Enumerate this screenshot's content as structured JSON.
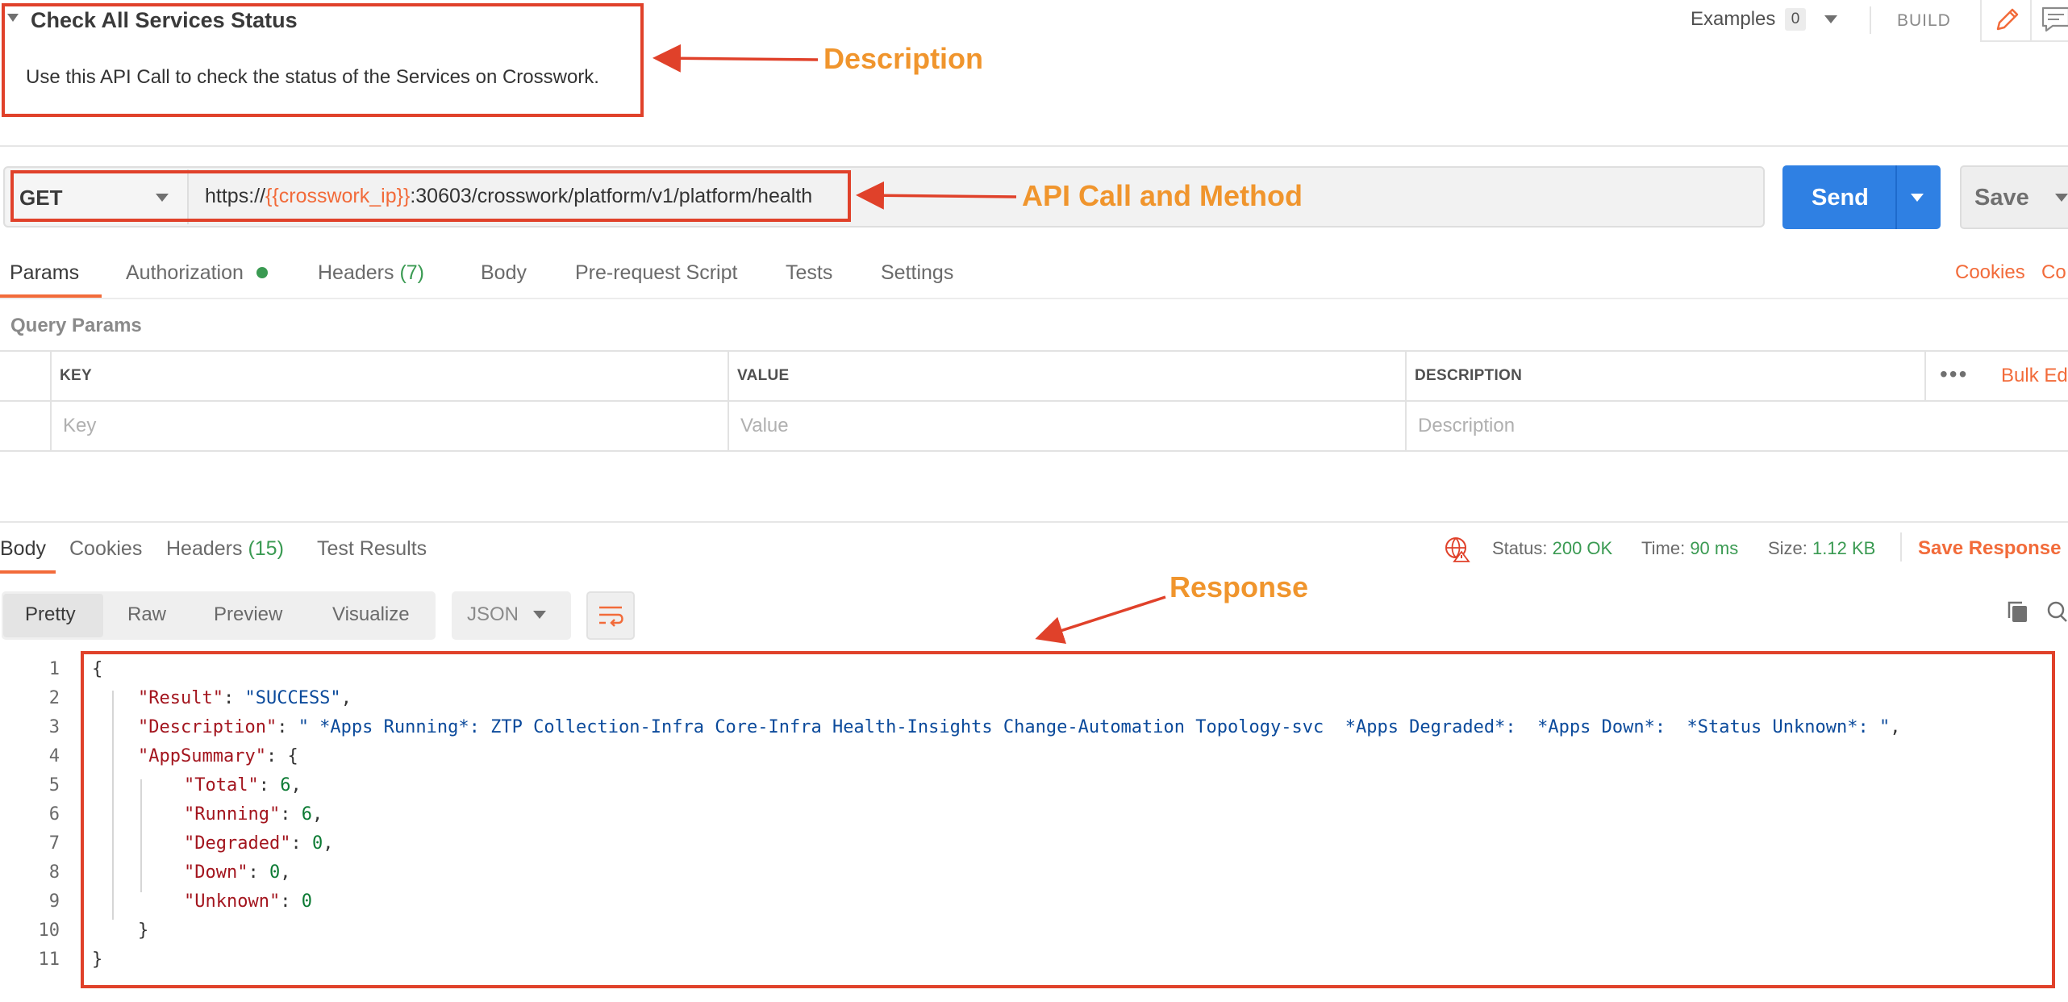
{
  "request": {
    "title": "Check All Services Status",
    "description": "Use this API Call to check the status of the Services on Crosswork.",
    "examples_label": "Examples",
    "examples_count": "0",
    "build_label": "BUILD",
    "method": "GET",
    "url_prefix": "https://",
    "url_variable": "{{crosswork_ip}}",
    "url_suffix": ":30603/crosswork/platform/v1/platform/health",
    "send_label": "Send",
    "save_label": "Save"
  },
  "request_tabs": {
    "params": "Params",
    "authorization": "Authorization",
    "headers": "Headers",
    "headers_count": "(7)",
    "body": "Body",
    "prerequest": "Pre-request Script",
    "tests": "Tests",
    "settings": "Settings",
    "cookies": "Cookies",
    "code_partial": "Co"
  },
  "query_params": {
    "title": "Query Params",
    "columns": [
      "KEY",
      "VALUE",
      "DESCRIPTION"
    ],
    "placeholders": [
      "Key",
      "Value",
      "Description"
    ],
    "bulk_edit": "Bulk Ed"
  },
  "response": {
    "tabs": {
      "body": "Body",
      "cookies": "Cookies",
      "headers": "Headers",
      "headers_count": "(15)",
      "test_results": "Test Results"
    },
    "status_label": "Status:",
    "status_value": "200 OK",
    "time_label": "Time:",
    "time_value": "90 ms",
    "size_label": "Size:",
    "size_value": "1.12 KB",
    "save_response": "Save Response",
    "formats": [
      "Pretty",
      "Raw",
      "Preview",
      "Visualize"
    ],
    "format_selected": "JSON",
    "lines": [
      {
        "n": "1",
        "text": "{"
      },
      {
        "n": "2",
        "key": "\"Result\"",
        "value": "\"SUCCESS\"",
        "type": "s",
        "tail": ","
      },
      {
        "n": "3",
        "key": "\"Description\"",
        "value": "\" *Apps Running*: ZTP Collection-Infra Core-Infra Health-Insights Change-Automation Topology-svc  *Apps Degraded*:  *Apps Down*:  *Status Unknown*: \"",
        "type": "s",
        "tail": ","
      },
      {
        "n": "4",
        "key": "\"AppSummary\"",
        "value": "{",
        "type": "p",
        "tail": ""
      },
      {
        "n": "5",
        "key": "\"Total\"",
        "value": "6",
        "type": "n",
        "tail": ","
      },
      {
        "n": "6",
        "key": "\"Running\"",
        "value": "6",
        "type": "n",
        "tail": ","
      },
      {
        "n": "7",
        "key": "\"Degraded\"",
        "value": "0",
        "type": "n",
        "tail": ","
      },
      {
        "n": "8",
        "key": "\"Down\"",
        "value": "0",
        "type": "n",
        "tail": ","
      },
      {
        "n": "9",
        "key": "\"Unknown\"",
        "value": "0",
        "type": "n",
        "tail": ""
      },
      {
        "n": "10",
        "text": "}"
      },
      {
        "n": "11",
        "text": "}"
      }
    ]
  },
  "annotations": {
    "description": "Description",
    "api_call": "API Call and Method",
    "response": "Response"
  },
  "colors": {
    "annotation_box": "#e0412a",
    "annotation_text": "#f0952d",
    "send": "#2f80e3",
    "accent": "#f26b3a",
    "success": "#3a9a52"
  }
}
